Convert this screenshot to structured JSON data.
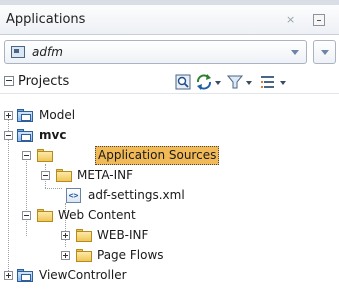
{
  "panel": {
    "title": "Applications",
    "close_glyph": "×",
    "minimize_icon": "minimize-icon"
  },
  "app_selector": {
    "value": "adfm",
    "icon": "application-icon"
  },
  "projects_bar": {
    "label": "Projects",
    "tools": [
      "find-icon",
      "sync-icon",
      "filter-icon",
      "options-icon"
    ]
  },
  "tree": {
    "model": "Model",
    "mvc": "mvc",
    "application_sources": "Application Sources",
    "meta_inf": "META-INF",
    "adf_settings": "adf-settings.xml",
    "xml_glyph": "<>",
    "web_content": "Web Content",
    "web_inf": "WEB-INF",
    "page_flows": "Page Flows",
    "view_controller": "ViewController",
    "selected": "Application Sources"
  },
  "colors": {
    "selection": "#f2b957",
    "folder": "#efc658",
    "project": "#8ab9ea"
  }
}
